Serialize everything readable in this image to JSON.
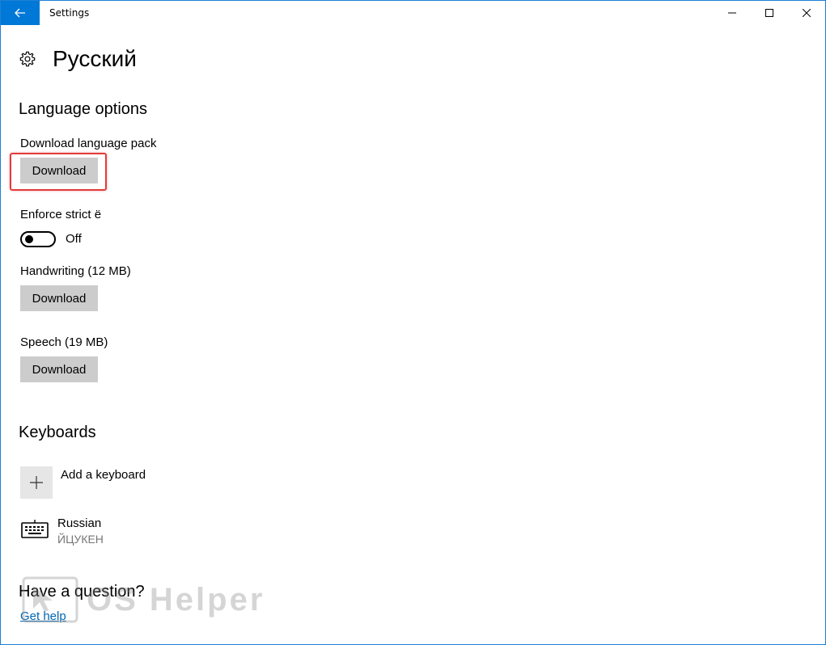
{
  "window": {
    "title": "Settings",
    "accent_color": "#0078d7"
  },
  "header": {
    "title": "Русский"
  },
  "language_options": {
    "section_title": "Language options",
    "language_pack": {
      "label": "Download language pack",
      "button_label": "Download"
    },
    "strict_e": {
      "label": "Enforce strict ё",
      "state": "Off"
    },
    "handwriting": {
      "label": "Handwriting (12 MB)",
      "button_label": "Download"
    },
    "speech": {
      "label": "Speech (19 MB)",
      "button_label": "Download"
    }
  },
  "keyboards": {
    "section_title": "Keyboards",
    "add_label": "Add a keyboard",
    "items": [
      {
        "name": "Russian",
        "layout": "ЙЦУКЕН"
      }
    ]
  },
  "help": {
    "question": "Have a question?",
    "link": "Get help"
  },
  "watermark": {
    "text": "OS Helper"
  }
}
